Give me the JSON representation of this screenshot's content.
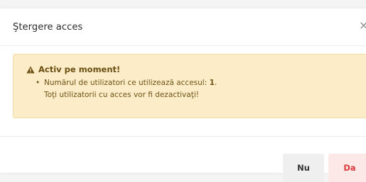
{
  "dialog": {
    "title": "Ştergere acces",
    "close_glyph": "×"
  },
  "alert": {
    "icon": "warning-triangle-icon",
    "title": "Activ pe moment!",
    "bullet": "•",
    "line1_text": "Numărul de utilizatori ce utilizează accesul: ",
    "line1_count": "1",
    "line1_suffix": ".",
    "line2_text": "Toţi utilizatorii cu acces vor fi dezactivaţi!"
  },
  "footer": {
    "no_label": "Nu",
    "yes_label": "Da"
  },
  "colors": {
    "alert_background": "#fcecc7",
    "alert_text": "#6e5316",
    "danger": "#d93a3a"
  }
}
